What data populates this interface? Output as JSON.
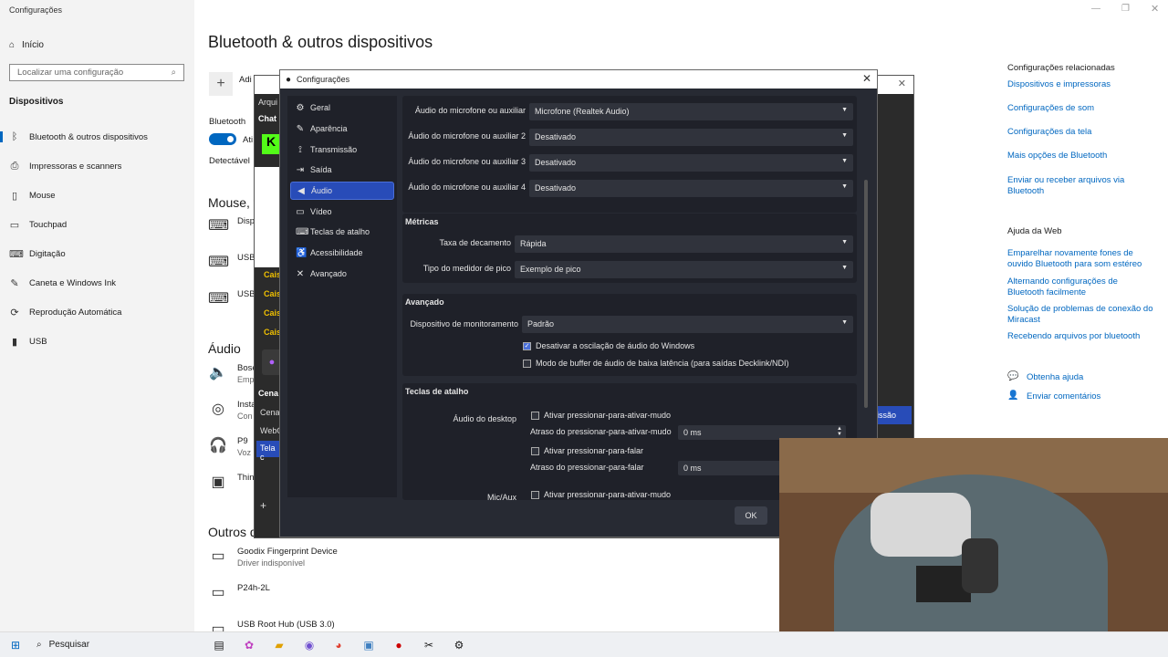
{
  "window": {
    "title": "Configurações"
  },
  "win_sidebar": {
    "home": "Início",
    "search_placeholder": "Localizar uma configuração",
    "section": "Dispositivos",
    "items": [
      {
        "label": "Bluetooth & outros dispositivos",
        "icon": "bluetooth-icon"
      },
      {
        "label": "Impressoras e scanners",
        "icon": "printer-icon"
      },
      {
        "label": "Mouse",
        "icon": "mouse-icon"
      },
      {
        "label": "Touchpad",
        "icon": "touchpad-icon"
      },
      {
        "label": "Digitação",
        "icon": "keyboard-icon"
      },
      {
        "label": "Caneta e Windows Ink",
        "icon": "pen-icon"
      },
      {
        "label": "Reprodução Automática",
        "icon": "autoplay-icon"
      },
      {
        "label": "USB",
        "icon": "usb-icon"
      }
    ]
  },
  "main": {
    "title": "Bluetooth & outros dispositivos",
    "add_label": "Adi",
    "bluetooth_label": "Bluetooth",
    "bluetooth_state": "Ati",
    "detectable": "Detectável",
    "mouse_head": "Mouse, t",
    "mouse_devices": [
      "Disp",
      "USB",
      "USB"
    ],
    "audio_head": "Áudio",
    "audio_devices": [
      {
        "name": "Bose",
        "sub": "Emp"
      },
      {
        "name": "Insta",
        "sub": "Con"
      },
      {
        "name": "P9",
        "sub": "Voz"
      },
      {
        "name": "Thin",
        "sub": ""
      }
    ],
    "others_head": "Outros d",
    "others": [
      {
        "name": "Goodix Fingerprint Device",
        "sub": "Driver indisponível"
      },
      {
        "name": "P24h-2L",
        "sub": ""
      },
      {
        "name": "USB Root Hub (USB 3.0)",
        "sub": ""
      }
    ]
  },
  "right_panel": {
    "related_head": "Configurações relacionadas",
    "related_links": [
      "Dispositivos e impressoras",
      "Configurações de som",
      "Configurações da tela",
      "Mais opções de Bluetooth",
      "Enviar ou receber arquivos via Bluetooth"
    ],
    "web_head": "Ajuda da Web",
    "web_links": [
      "Emparelhar novamente fones de ouvido Bluetooth para som estéreo",
      "Alternando configurações de Bluetooth facilmente",
      "Solução de problemas de conexão do Miracast",
      "Recebendo arquivos por bluetooth"
    ],
    "help": "Obtenha ajuda",
    "feedback": "Enviar comentários"
  },
  "obs_bg": {
    "menu": "Arqui",
    "chat": "Chat",
    "casi": "Cais",
    "scenes_head": "Cena",
    "scenes": [
      "Cena",
      "WebC",
      "Tela c"
    ],
    "transmit": "issão"
  },
  "dialog": {
    "title": "Configurações",
    "nav": [
      {
        "label": "Geral",
        "icon": "gear-icon"
      },
      {
        "label": "Aparência",
        "icon": "brush-icon"
      },
      {
        "label": "Transmissão",
        "icon": "antenna-icon"
      },
      {
        "label": "Saída",
        "icon": "output-icon"
      },
      {
        "label": "Áudio",
        "icon": "speaker-icon"
      },
      {
        "label": "Vídeo",
        "icon": "monitor-icon"
      },
      {
        "label": "Teclas de atalho",
        "icon": "keyboard-icon"
      },
      {
        "label": "Acessibilidade",
        "icon": "accessibility-icon"
      },
      {
        "label": "Avançado",
        "icon": "tools-icon"
      }
    ],
    "mics": [
      {
        "label": "Áudio do microfone ou auxiliar",
        "value": "Microfone (Realtek Audio)"
      },
      {
        "label": "Áudio do microfone ou auxiliar 2",
        "value": "Desativado"
      },
      {
        "label": "Áudio do microfone ou auxiliar 3",
        "value": "Desativado"
      },
      {
        "label": "Áudio do microfone ou auxiliar 4",
        "value": "Desativado"
      }
    ],
    "metrics_head": "Métricas",
    "decay_label": "Taxa de decamento",
    "decay_value": "Rápida",
    "peak_label": "Tipo do medidor de pico",
    "peak_value": "Exemplo de pico",
    "advanced_head": "Avançado",
    "monitor_label": "Dispositivo de monitoramento",
    "monitor_value": "Padrão",
    "cb_ducking": "Desativar a oscilação de áudio do Windows",
    "cb_lowlat": "Modo de buffer de áudio de baixa latência (para saídas Decklink/NDI)",
    "hotkeys_head": "Teclas de atalho",
    "desktop_label": "Áudio do desktop",
    "ptm_label": "Ativar pressionar-para-ativar-mudo",
    "ptm_delay": "Atraso do pressionar-para-ativar-mudo",
    "ptm_delay_value": "0 ms",
    "ptt_label": "Ativar pressionar-para-falar",
    "ptt_delay": "Atraso do pressionar-para-falar",
    "ptt_delay_value": "0 ms",
    "micaux_label": "Mic/Aux",
    "micaux_ptm": "Ativar pressionar-para-ativar-mudo",
    "ok": "OK"
  },
  "taskbar": {
    "search": "Pesquisar"
  }
}
